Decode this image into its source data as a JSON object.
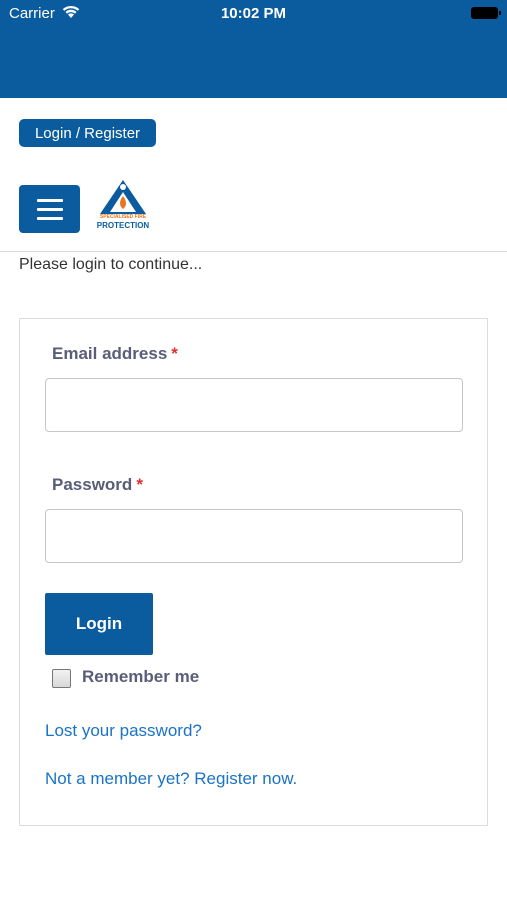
{
  "status_bar": {
    "carrier": "Carrier",
    "time": "10:02 PM",
    "icons": [
      "wifi-icon",
      "battery-icon"
    ]
  },
  "header": {
    "login_register_label": "Login / Register",
    "menu_icon": "hamburger-menu-icon",
    "logo": {
      "line1": "SPECIALISED FIRE",
      "line2": "PROTECTION"
    }
  },
  "main": {
    "prompt": "Please login to continue..."
  },
  "form": {
    "email_label": "Email address",
    "password_label": "Password",
    "required_marker": "*",
    "email_value": "",
    "password_value": "",
    "login_label": "Login",
    "remember_label": "Remember me",
    "remember_checked": false,
    "lost_password_link": "Lost your password?",
    "register_link": "Not a member yet? Register now."
  },
  "colors": {
    "brand_blue": "#0b5c9e",
    "link_blue": "#1a73c6",
    "required_red": "#e03131",
    "label_text": "#5a5d78",
    "logo_orange": "#e87722"
  }
}
